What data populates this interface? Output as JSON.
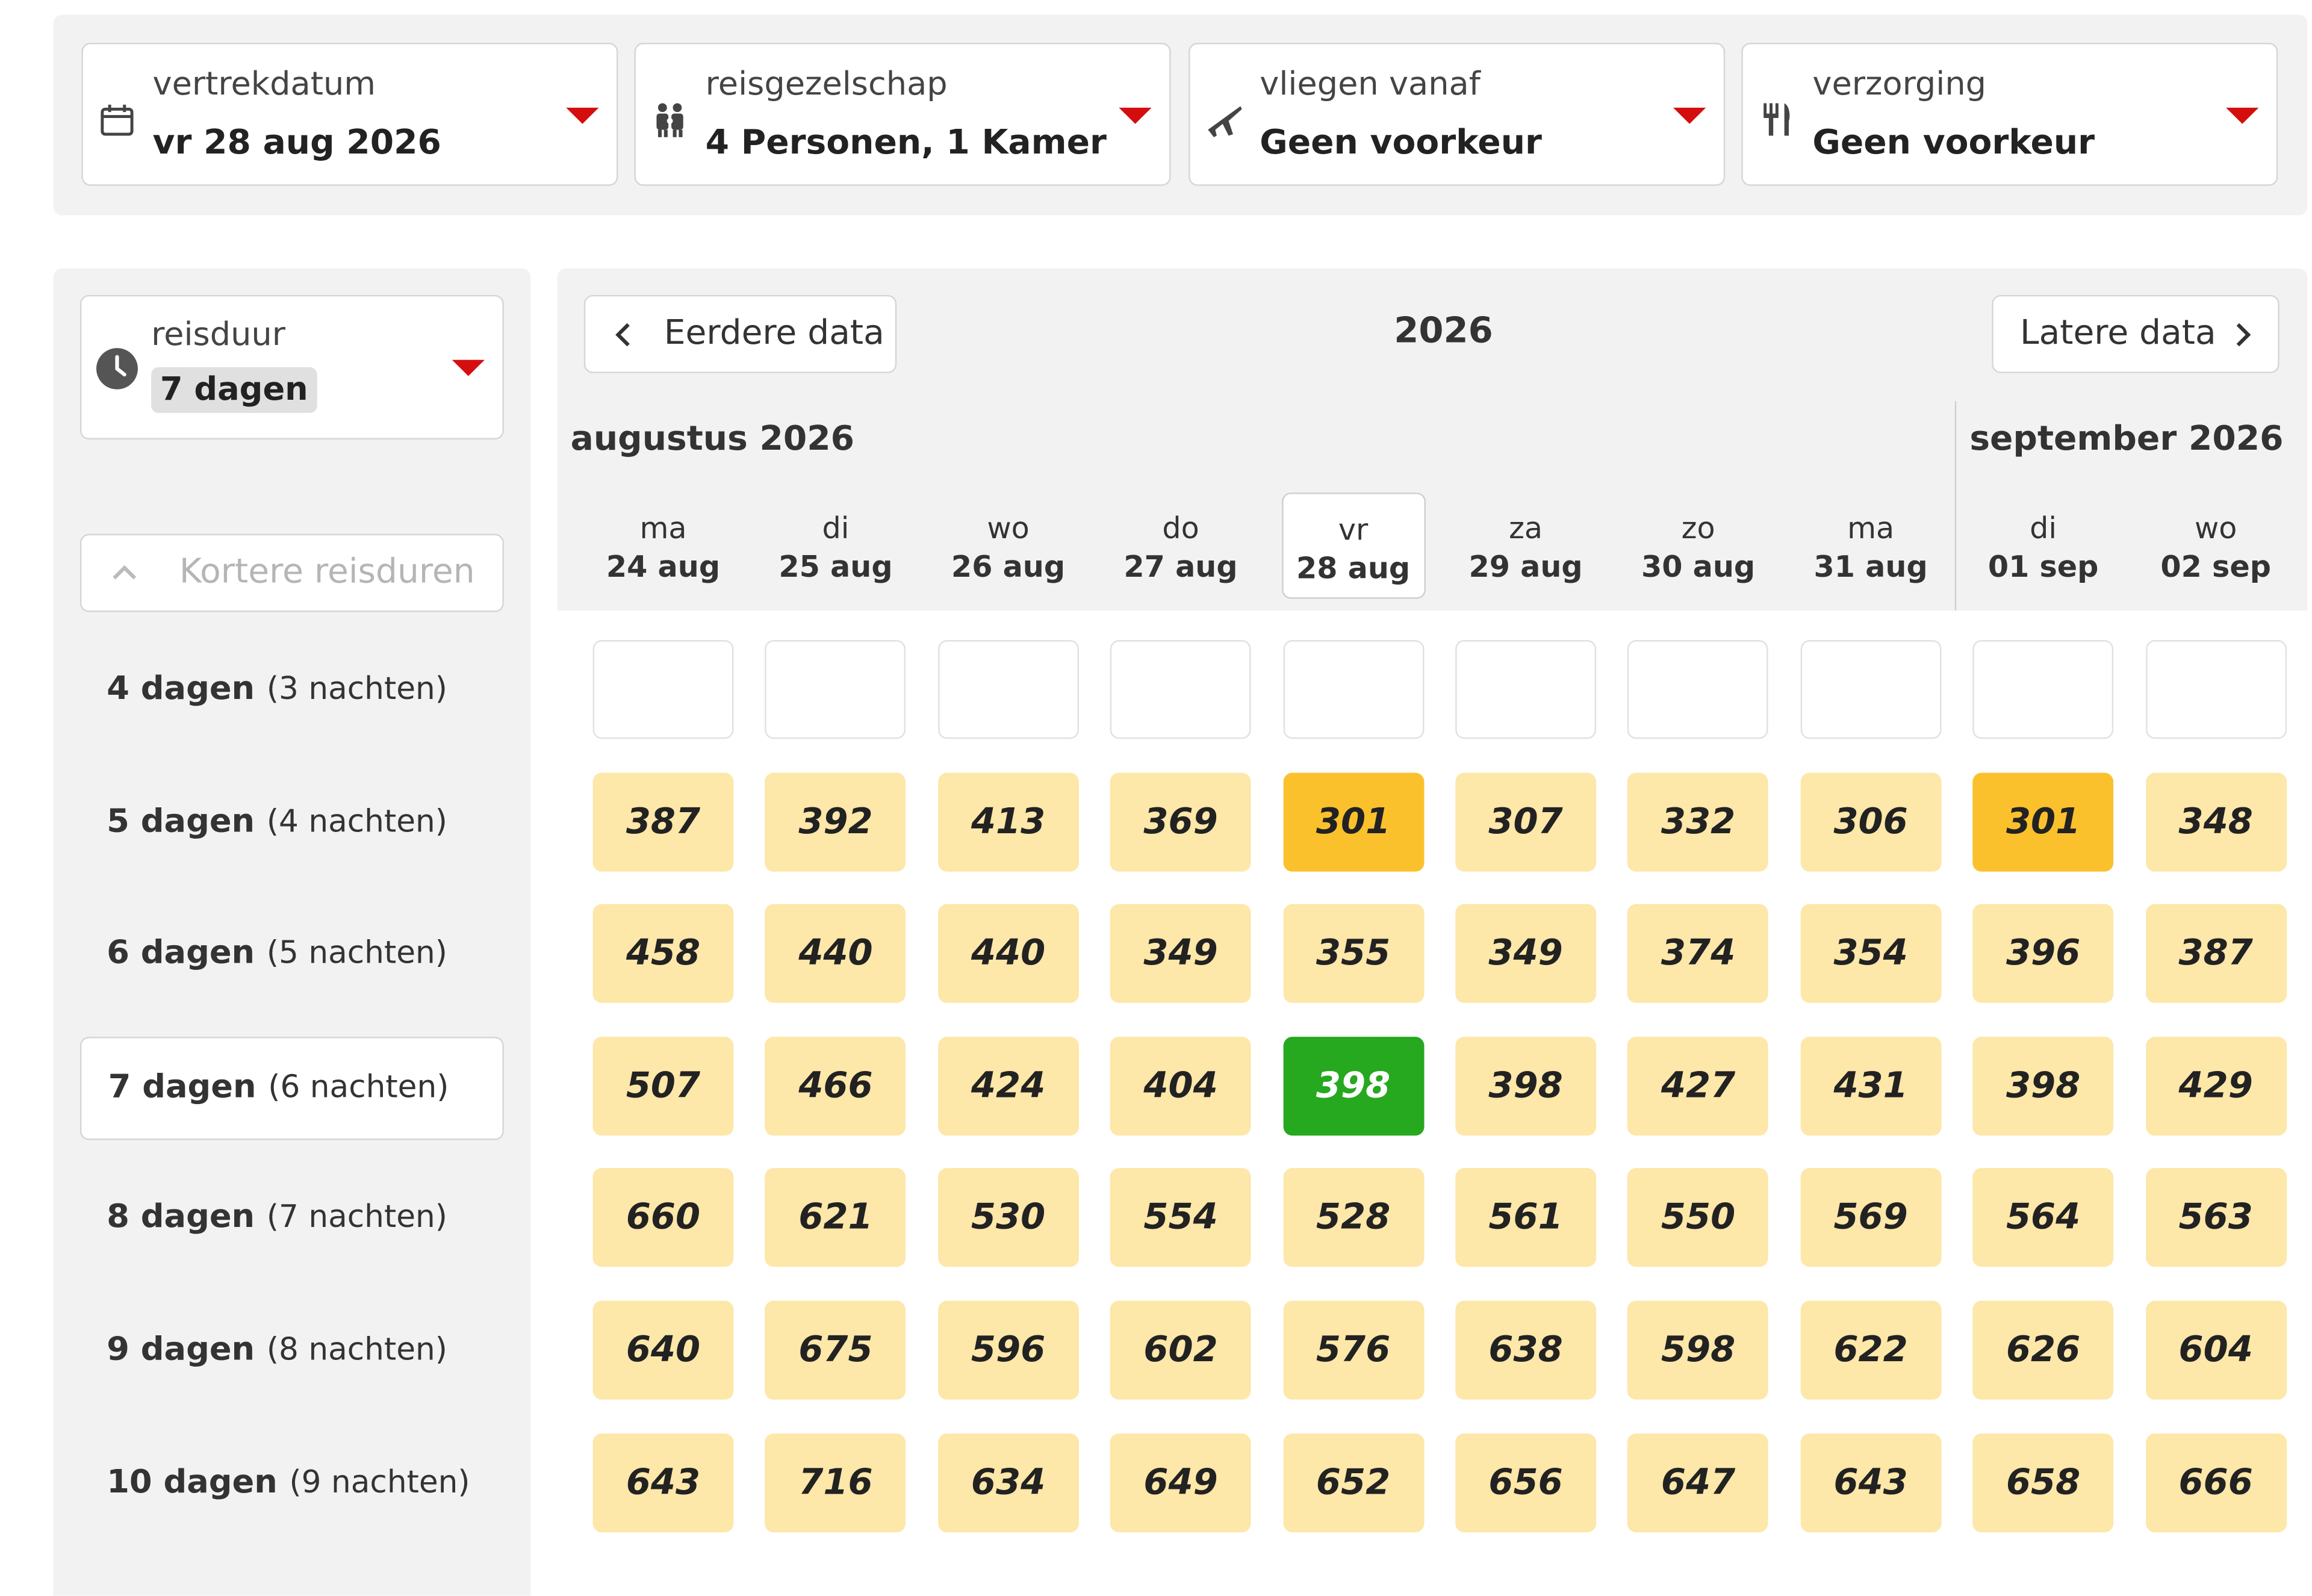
{
  "filters": [
    {
      "icon": "calendar-icon",
      "label": "vertrekdatum",
      "value": "vr 28 aug 2026"
    },
    {
      "icon": "family-icon",
      "label": "reisgezelschap",
      "value": "4 Personen, 1 Kamer"
    },
    {
      "icon": "airplane-icon",
      "label": "vliegen vanaf",
      "value": "Geen voorkeur"
    },
    {
      "icon": "cutlery-icon",
      "label": "verzorging",
      "value": "Geen voorkeur"
    }
  ],
  "duration_select": {
    "icon": "clock-icon",
    "label": "reisduur",
    "value": "7 dagen"
  },
  "shorter_durations": "Kortere reisduren",
  "durations": [
    {
      "days": "4 dagen",
      "nights": "(3 nachten)",
      "selected": false
    },
    {
      "days": "5 dagen",
      "nights": "(4 nachten)",
      "selected": false
    },
    {
      "days": "6 dagen",
      "nights": "(5 nachten)",
      "selected": false
    },
    {
      "days": "7 dagen",
      "nights": "(6 nachten)",
      "selected": true
    },
    {
      "days": "8 dagen",
      "nights": "(7 nachten)",
      "selected": false
    },
    {
      "days": "9 dagen",
      "nights": "(8 nachten)",
      "selected": false
    },
    {
      "days": "10 dagen",
      "nights": "(9 nachten)",
      "selected": false
    }
  ],
  "calendar": {
    "earlier": "Eerdere data",
    "later": "Latere data",
    "year": "2026",
    "months": [
      "augustus 2026",
      "september 2026"
    ],
    "days": [
      {
        "name": "ma",
        "date": "24 aug"
      },
      {
        "name": "di",
        "date": "25 aug"
      },
      {
        "name": "wo",
        "date": "26 aug"
      },
      {
        "name": "do",
        "date": "27 aug"
      },
      {
        "name": "vr",
        "date": "28 aug",
        "selected": true
      },
      {
        "name": "za",
        "date": "29 aug"
      },
      {
        "name": "zo",
        "date": "30 aug"
      },
      {
        "name": "ma",
        "date": "31 aug"
      },
      {
        "name": "di",
        "date": "01 sep"
      },
      {
        "name": "wo",
        "date": "02 sep"
      }
    ]
  },
  "prices": [
    [
      "",
      "",
      "",
      "",
      "",
      "",
      "",
      "",
      "",
      ""
    ],
    [
      "387",
      "392",
      "413",
      "369",
      "301",
      "307",
      "332",
      "306",
      "301",
      "348"
    ],
    [
      "458",
      "440",
      "440",
      "349",
      "355",
      "349",
      "374",
      "354",
      "396",
      "387"
    ],
    [
      "507",
      "466",
      "424",
      "404",
      "398",
      "398",
      "427",
      "431",
      "398",
      "429"
    ],
    [
      "660",
      "621",
      "530",
      "554",
      "528",
      "561",
      "550",
      "569",
      "564",
      "563"
    ],
    [
      "640",
      "675",
      "596",
      "602",
      "576",
      "638",
      "598",
      "622",
      "626",
      "604"
    ],
    [
      "643",
      "716",
      "634",
      "649",
      "652",
      "656",
      "647",
      "643",
      "658",
      "666"
    ]
  ],
  "highlights": {
    "cheapest": [
      [
        1,
        4
      ],
      [
        1,
        8
      ]
    ],
    "current": [
      3,
      4
    ]
  },
  "colors": {
    "accent_red": "#d40e0e",
    "price_cell": "#fde7a9",
    "cheapest_cell": "#fbc12d",
    "current_cell": "#26a81f"
  }
}
